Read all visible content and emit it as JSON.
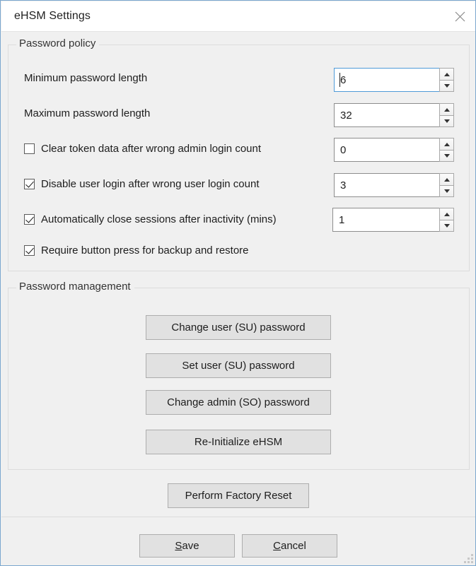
{
  "window": {
    "title": "eHSM Settings",
    "close_icon": "close-icon",
    "accent_border": "#7ba7cf",
    "background": "#f0f0f0"
  },
  "password_policy": {
    "legend": "Password policy",
    "rows": [
      {
        "kind": "label",
        "label": "Minimum password length",
        "value": "6",
        "focused": true
      },
      {
        "kind": "label",
        "label": "Maximum password length",
        "value": "32",
        "focused": false
      },
      {
        "kind": "checkbox",
        "label": "Clear token data after wrong admin login count",
        "checked": false,
        "value": "0",
        "focused": false
      },
      {
        "kind": "checkbox",
        "label": "Disable user login after wrong user login count",
        "checked": true,
        "value": "3",
        "focused": false
      },
      {
        "kind": "checkbox",
        "label": "Automatically close sessions after inactivity (mins)",
        "checked": true,
        "value": "1",
        "focused": false
      },
      {
        "kind": "checkbox",
        "label": "Require button press for backup and restore",
        "checked": true,
        "value": null,
        "focused": false
      }
    ]
  },
  "password_management": {
    "legend": "Password management",
    "buttons": [
      "Change user (SU) password",
      "Set user (SU) password",
      "Change admin (SO) password",
      "Re-Initialize eHSM"
    ]
  },
  "factory": {
    "reset_label": "Perform Factory Reset"
  },
  "footer": {
    "save_mnemonic": "S",
    "save_rest": "ave",
    "cancel_mnemonic": "C",
    "cancel_rest": "ancel"
  }
}
